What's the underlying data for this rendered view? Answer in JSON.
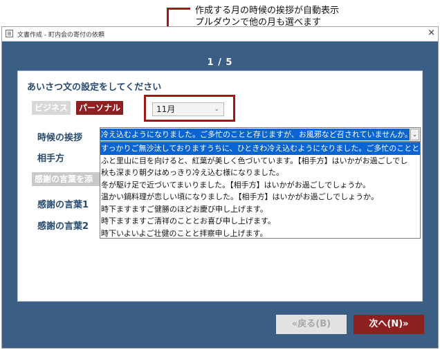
{
  "annotation": {
    "line1": "作成する月の時候の挨拶が自動表示",
    "line2": "プルダウンで他の月も選べます"
  },
  "window": {
    "title": "文書作成 - 町内会の寄付の依頼",
    "close": "×",
    "page_indicator": "1 / 5"
  },
  "panel": {
    "section_title": "あいさつ文の設定をしてください",
    "tag_business": "ビジネス",
    "tag_personal": "パーソナル",
    "month_value": "11月",
    "label_jikou": "時候の挨拶",
    "label_aite": "相手方",
    "label_kansha_add": "感謝の言葉を添",
    "label_kansha1": "感謝の言葉1",
    "label_kansha2": "感謝の言葉2",
    "combo_value": "冷え込むようになりました。ご多忙のことと存じますが、お風邪など召されていませんか。",
    "dropdown_items": [
      "すっかりご無沙汰しておりますうちに、ひときわ冷え込むようになりました。ご多忙のことと存",
      "ふと里山に目を向けると、紅葉が美しく色づいています。【相手方】はいかがお過ごしでし",
      "秋も深まり朝夕はめっきり冷え込む様になりました。",
      "冬が駆け足で近づいてまいりました。【相手方】はいかがお過ごしでしょうか。",
      "温かい鍋料理が恋しい頃になりました。【相手方】はいかがお過ごしでしょうか。",
      "時下ますますご健勝のほどお慶び申し上げます。",
      "時下ますますご清祥のこととお喜び申し上げます。",
      "時下いよいよご壮健のことと拝察申し上げます。"
    ]
  },
  "buttons": {
    "back": "«戻る(B)",
    "next": "次へ(N)»"
  },
  "colors": {
    "accent_red": "#8e2020",
    "window_bg": "#3a5e84",
    "highlight": "#0a64d2"
  }
}
